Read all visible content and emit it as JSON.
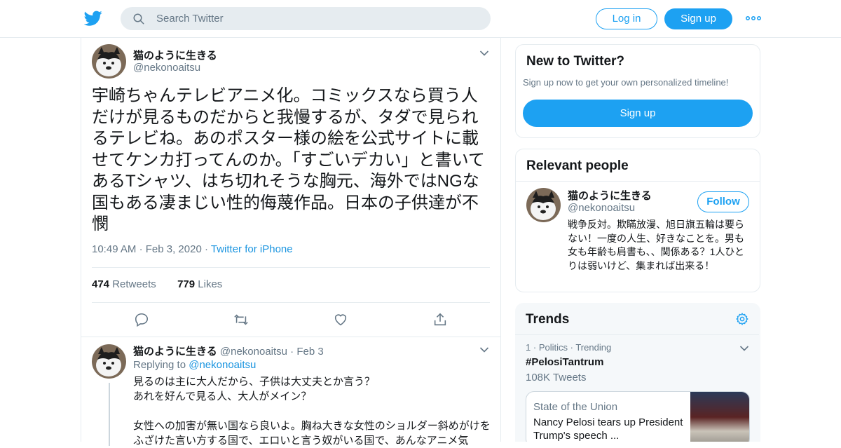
{
  "header": {
    "search_placeholder": "Search Twitter",
    "login_label": "Log in",
    "signup_label": "Sign up"
  },
  "tweet": {
    "display_name": "猫のように生きる",
    "handle": "@nekonoaitsu",
    "text": "宇崎ちゃんテレビアニメ化。コミックスなら買う人だけが見るものだからと我慢するが、タダで見られるテレビね。あのポスター様の絵を公式サイトに載せてケンカ打ってんのか。「すごいデカい」と書いてあるTシャツ、はち切れそうな胸元、海外ではNGな国もある凄まじい性的侮蔑作品。日本の子供達が不憫",
    "time": "10:49 AM",
    "date": "Feb 3, 2020",
    "source": "Twitter for iPhone",
    "retweets_count": "474",
    "retweets_label": "Retweets",
    "likes_count": "779",
    "likes_label": "Likes"
  },
  "reply": {
    "display_name": "猫のように生きる",
    "handle": "@nekonoaitsu",
    "date": "Feb 3",
    "replying_label": "Replying to",
    "replying_handle": "@nekonoaitsu",
    "text": "見るのは主に大人だから、子供は大丈夫とか言う？\nあれを好んで見る人、大人がメイン？\n\n女性への加害が無い国なら良いよ。胸ね大きな女性のショルダー斜めがけをふざけた言い方する国で、エロいと言う奴がいる国で、あんなアニメ気"
  },
  "new_to_twitter": {
    "title": "New to Twitter?",
    "subtitle": "Sign up now to get your own personalized timeline!",
    "button": "Sign up"
  },
  "relevant_people": {
    "title": "Relevant people",
    "name": "猫のように生きる",
    "handle": "@nekonoaitsu",
    "follow_label": "Follow",
    "bio": "戦争反対。欺瞞放漫、旭日旗五輪は要らない！一度の人生、好きなことを。男も女も年齢も肩書も、、関係ある？1人ひとりは弱いけど、集まれば出来る！"
  },
  "trends": {
    "title": "Trends",
    "rank": "1",
    "category": "Politics",
    "status": "Trending",
    "name": "#PelosiTantrum",
    "count": "108K Tweets",
    "news_source": "State of the Union",
    "news_title": "Nancy Pelosi tears up President Trump's speech ..."
  },
  "colors": {
    "accent": "#1da1f2",
    "link": "#1b95e0",
    "muted": "#657786",
    "border": "#e6ecf0"
  },
  "icons": [
    "twitter-bird-icon",
    "search-icon",
    "more-dots-icon",
    "chevron-down-icon",
    "reply-icon",
    "retweet-icon",
    "like-heart-icon",
    "share-icon",
    "gear-icon"
  ]
}
